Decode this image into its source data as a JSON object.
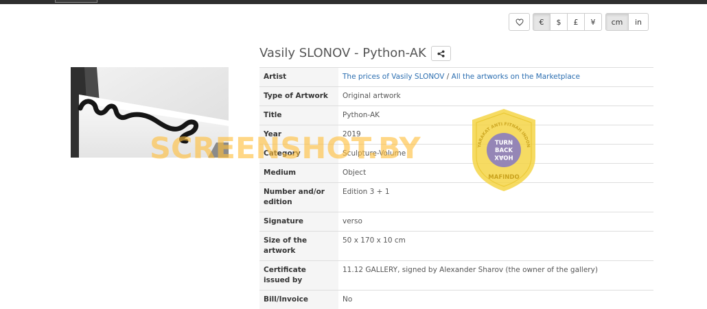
{
  "toolbar": {
    "currencies": [
      "€",
      "$",
      "£",
      "¥"
    ],
    "currency_selected": "€",
    "units": [
      "cm",
      "in"
    ],
    "unit_selected": "cm"
  },
  "artwork": {
    "heading": "Vasily SLONOV - Python-AK"
  },
  "details": {
    "artist": {
      "label": "Artist",
      "link_prices": "The prices of Vasily SLONOV",
      "separator": " / ",
      "link_marketplace": "All the artworks on the Marketplace"
    },
    "type": {
      "label": "Type of Artwork",
      "value": "Original artwork"
    },
    "title": {
      "label": "Title",
      "value": "Python-AK"
    },
    "year": {
      "label": "Year",
      "value": "2019"
    },
    "category": {
      "label": "Category",
      "value": "Sculpture-Volume"
    },
    "medium": {
      "label": "Medium",
      "value": "Object"
    },
    "edition": {
      "label": "Number and/or edition",
      "value": "Edition 3 + 1"
    },
    "signature": {
      "label": "Signature",
      "value": "verso"
    },
    "size": {
      "label": "Size of the artwork",
      "value": "50 x 170 x 10 cm"
    },
    "certificate": {
      "label": "Certificate issued by",
      "value": "11.12 GALLERY, signed by Alexander Sharov (the owner of the gallery)"
    },
    "bill": {
      "label": "Bill/Invoice",
      "value": "No"
    }
  },
  "overlay": {
    "watermark": "SCREENSHOT.BY",
    "badge_arc_top": "MASYARAKAT ANTI FITNAH INDONESIA",
    "badge_center": [
      "TURN",
      "BACK",
      "HOAX"
    ],
    "badge_bottom": "MAFINDO"
  },
  "colors": {
    "link": "#2a6db0",
    "topbar": "#2f2f2f",
    "watermark": "#ffbe3c",
    "badge_yellow": "#f5d547",
    "badge_purple": "#8b7cc0"
  },
  "icons": {
    "favorite": "heart-icon",
    "share": "share-icon"
  }
}
